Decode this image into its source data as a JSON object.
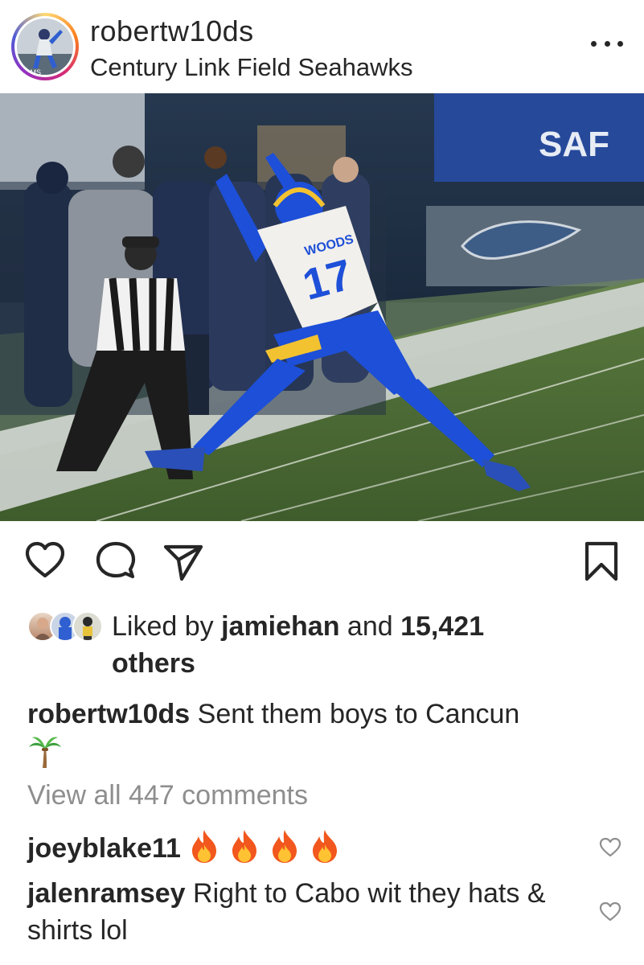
{
  "post": {
    "username": "robertw10ds",
    "location": "Century Link Field Seahawks",
    "photo": {
      "jersey_name": "WOODS",
      "jersey_number": "17",
      "stadium_sign": "SAF"
    }
  },
  "actions": {
    "icons": [
      "heart-icon",
      "comment-icon",
      "share-icon",
      "bookmark-icon"
    ]
  },
  "likes": {
    "prefix": "Liked by ",
    "user": "jamiehan",
    "middle": " and ",
    "count": "15,421",
    "suffix": "others"
  },
  "caption": {
    "user": "robertw10ds",
    "text": "Sent them boys to Cancun",
    "emoji": "palm-tree"
  },
  "view_all": "View all 447 comments",
  "comments": [
    {
      "user": "joeyblake11",
      "text": "",
      "emoji": "fire",
      "emoji_count": 4
    },
    {
      "user": "jalenramsey",
      "text": "Right to Cabo wit they hats & shirts lol"
    }
  ],
  "colors": {
    "text": "#262626",
    "muted": "#8e8e8e",
    "rams_blue": "#1d4fd8",
    "rams_gold": "#f2c230",
    "field_green": "#4a6a34"
  }
}
